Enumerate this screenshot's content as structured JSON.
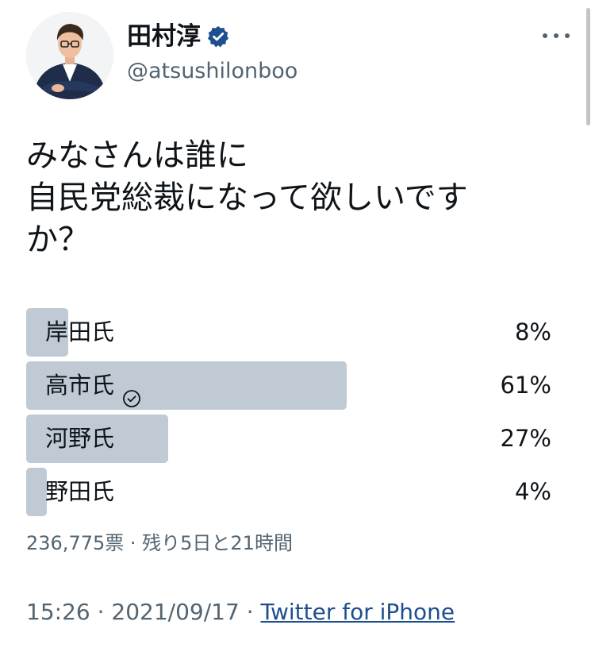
{
  "author": {
    "display_name": "田村淳",
    "handle": "@atsushilonboo",
    "verified": true
  },
  "tweet": {
    "text_lines": [
      "みなさんは誰に",
      "自民党総裁になって欲しいです",
      "か？"
    ]
  },
  "poll": {
    "options": [
      {
        "label": "岸田氏",
        "percent_text": "8%",
        "percent": 8,
        "selected": false
      },
      {
        "label": "高市氏",
        "percent_text": "61%",
        "percent": 61,
        "selected": true
      },
      {
        "label": "河野氏",
        "percent_text": "27%",
        "percent": 27,
        "selected": false
      },
      {
        "label": "野田氏",
        "percent_text": "4%",
        "percent": 4,
        "selected": false
      }
    ],
    "summary": "236,775票 · 残り5日と21時間"
  },
  "meta": {
    "time": "15:26",
    "separator": " · ",
    "date": "2021/09/17",
    "source": "Twitter for iPhone"
  },
  "colors": {
    "poll_bar": "#bfcad4",
    "verified_badge": "#1d4f8f",
    "secondary_text": "#536471",
    "link": "#1d4f8f"
  }
}
